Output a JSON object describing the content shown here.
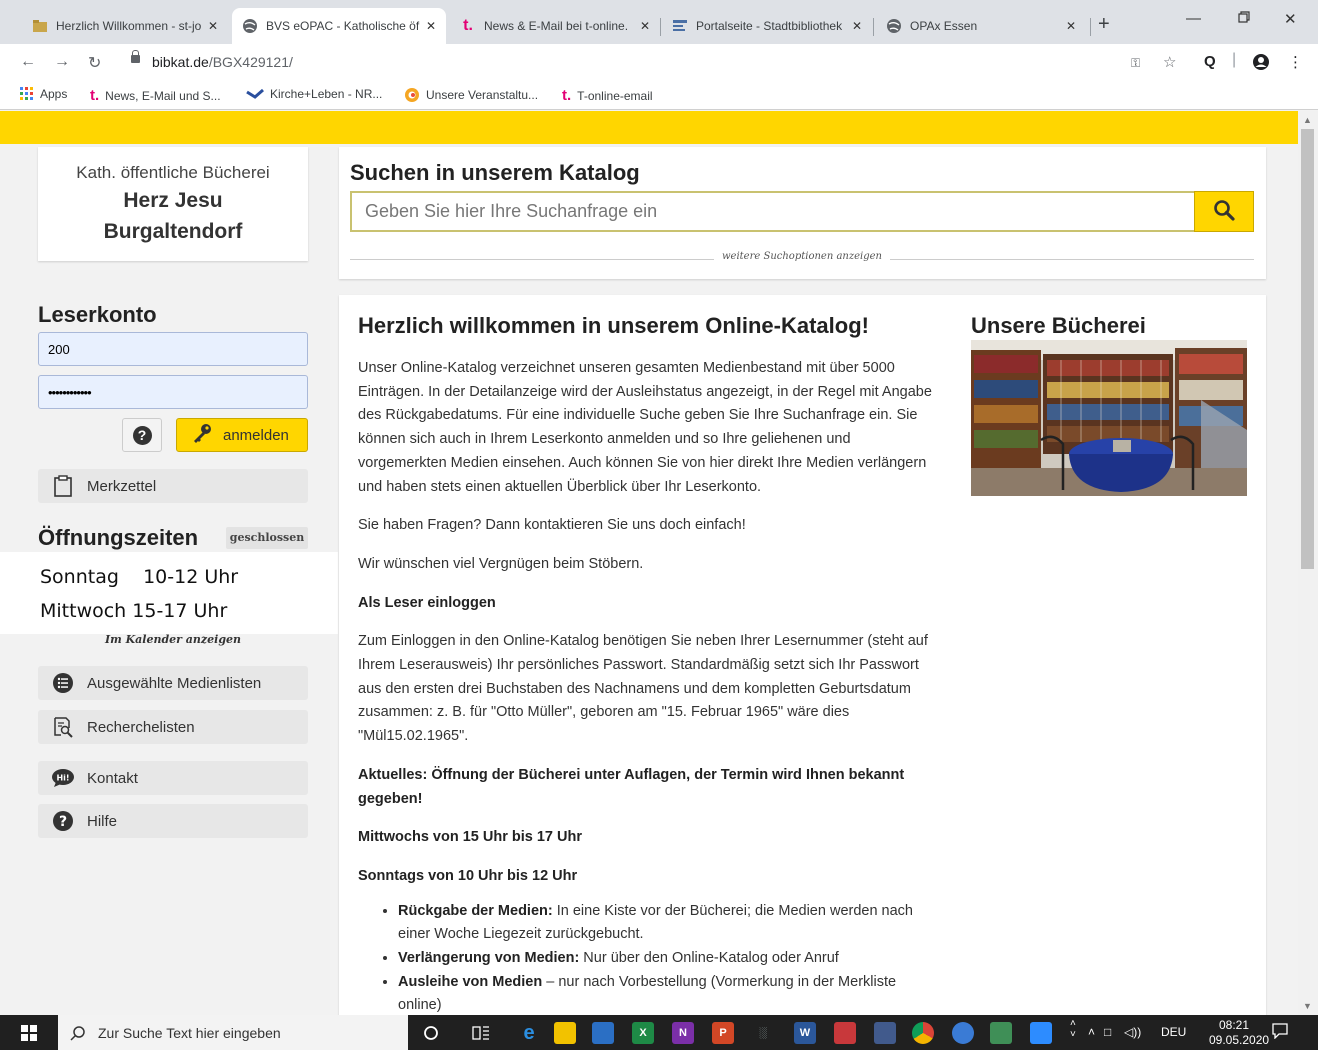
{
  "browser": {
    "tabs": [
      {
        "title": "Herzlich Willkommen - st-jo",
        "icon": "folder-icon"
      },
      {
        "title": "BVS eOPAC - Katholische öf",
        "icon": "globe-icon"
      },
      {
        "title": "News & E-Mail bei t-online.",
        "icon": "t-online-icon"
      },
      {
        "title": "Portalseite - Stadtbibliothek",
        "icon": "library-icon"
      },
      {
        "title": "OPAx Essen",
        "icon": "globe-icon"
      }
    ],
    "active_tab": 1,
    "close_glyph": "✕",
    "new_tab": "+",
    "url_host": "bibkat.de",
    "url_path": "/BGX429121/",
    "bookmarks": [
      {
        "label": "Apps",
        "icon": "apps-grid-icon"
      },
      {
        "label": "News, E-Mail und S...",
        "icon": "t-online-icon"
      },
      {
        "label": "Kirche+Leben - NR...",
        "icon": "kirche-leben-icon"
      },
      {
        "label": "Unsere Veranstaltu...",
        "icon": "events-icon"
      },
      {
        "label": "T-online-email",
        "icon": "t-online-icon"
      }
    ],
    "colors": {
      "tabbar": "#dee1e6",
      "t_online": "#e20074"
    }
  },
  "sidebar": {
    "library_type": "Kath. öffentliche Bücherei",
    "library_name_1": "Herz Jesu",
    "library_name_2": "Burgaltendorf",
    "account_title": "Leserkonto",
    "reader_number": "200",
    "password_mask": "••••••••••••",
    "help_label": "?",
    "login_label": "anmelden",
    "notes_label": "Merkzettel",
    "hours_title": "Öffnungszeiten",
    "status_badge": "geschlossen",
    "hours_sunday": "Sonntag    10-12 Uhr",
    "hours_wednesday": "Mittwoch 15-17 Uhr",
    "calendar_link": "Im Kalender anzeigen",
    "menu": [
      {
        "label": "Ausgewählte Medienlisten",
        "icon": "list-icon"
      },
      {
        "label": "Recherchelisten",
        "icon": "research-list-icon"
      },
      {
        "label": "Kontakt",
        "icon": "contact-bubble-icon"
      },
      {
        "label": "Hilfe",
        "icon": "help-icon"
      }
    ]
  },
  "search": {
    "title": "Suchen in unserem Katalog",
    "placeholder": "Geben Sie hier Ihre Suchanfrage ein",
    "more_options": "weitere Suchoptionen anzeigen"
  },
  "main": {
    "title": "Herzlich willkommen in unserem Online-Katalog!",
    "p1": "Unser Online-Katalog verzeichnet unseren gesamten Medienbestand mit über 5000 Einträgen. In der Detailanzeige wird der Ausleihstatus angezeigt, in der Regel mit Angabe des Rückgabedatums. Für eine individuelle Suche geben Sie Ihre Suchanfrage ein. Sie können sich auch in Ihrem Leserkonto anmelden und so Ihre geliehenen und vorgemerkten Medien einsehen. Auch können Sie von hier direkt Ihre Medien verlängern und haben stets einen aktuellen Überblick über Ihr Leserkonto.",
    "p2": "Sie haben Fragen? Dann kontaktieren Sie uns doch einfach!",
    "p3": "Wir wünschen viel Vergnügen beim Stöbern.",
    "h_login": "Als Leser einloggen",
    "p4": "Zum Einloggen in den Online-Katalog benötigen Sie neben Ihrer Lesernummer (steht auf Ihrem Leserausweis) Ihr persönliches Passwort. Standardmäßig setzt sich Ihr Passwort aus den ersten drei Buchstaben des Nachnamens und dem kompletten Geburtsdatum zusammen: z. B. für \"Otto Müller\", geboren am \"15. Februar 1965\" wäre dies \"Mül15.02.1965\".",
    "h_news": "Aktuelles: Öffnung der Bücherei unter Auflagen, der Termin wird Ihnen bekannt gegeben!",
    "h_wed": "Mittwochs von 15 Uhr bis 17 Uhr",
    "h_sun": "Sonntags von 10 Uhr bis 12 Uhr",
    "bullets": [
      {
        "bold": "Rückgabe der Medien:",
        "text": " In eine Kiste vor der Bücherei; die Medien werden nach einer Woche Liegezeit zurückgebucht."
      },
      {
        "bold": "Verlängerung von Medien:",
        "text": " Nur über den Online-Katalog oder Anruf"
      },
      {
        "bold": "Ausleihe von Medien",
        "text": " – nur nach Vorbestellung (Vormerkung in der Merkliste online)"
      }
    ],
    "library_title": "Unsere Bücherei",
    "photo_icon": "library-photo"
  },
  "taskbar": {
    "search_placeholder": "Zur Suche Text hier eingeben",
    "language": "DEU",
    "time": "08:21",
    "date": "09.05.2020"
  },
  "colors": {
    "accent": "#ffd600",
    "page_bg": "#f2f2f2"
  }
}
